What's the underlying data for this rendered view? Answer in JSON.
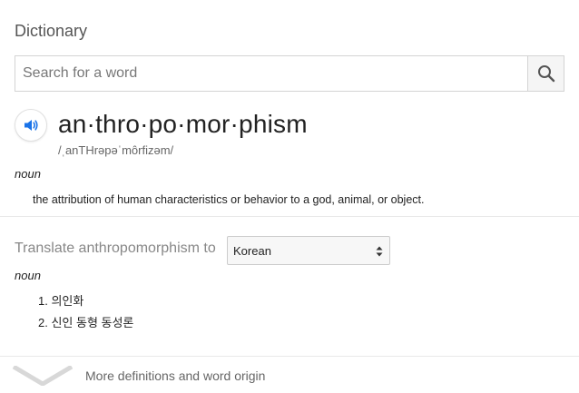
{
  "card": {
    "title": "Dictionary"
  },
  "search": {
    "placeholder": "Search for a word",
    "value": ""
  },
  "entry": {
    "headword": "an·thro·po·mor·phism",
    "phonetic": "/ˌanTHrəpəˈmôrfizəm/",
    "sense": {
      "part_of_speech": "noun",
      "definition": "the attribution of human characteristics or behavior to a god, animal, or object."
    }
  },
  "translate": {
    "label": "Translate anthropomorphism to",
    "selected_language": "Korean",
    "part_of_speech": "noun",
    "results": [
      "1. 의인화",
      "2. 신인 동형 동성론"
    ]
  },
  "footer": {
    "more_label": "More definitions and word origin"
  },
  "icons": {
    "speaker": "speaker-icon",
    "search": "search-icon",
    "chevron": "chevron-down-icon"
  },
  "colors": {
    "speaker_accent": "#1a73e8",
    "chevron": "#d8d8d8"
  }
}
